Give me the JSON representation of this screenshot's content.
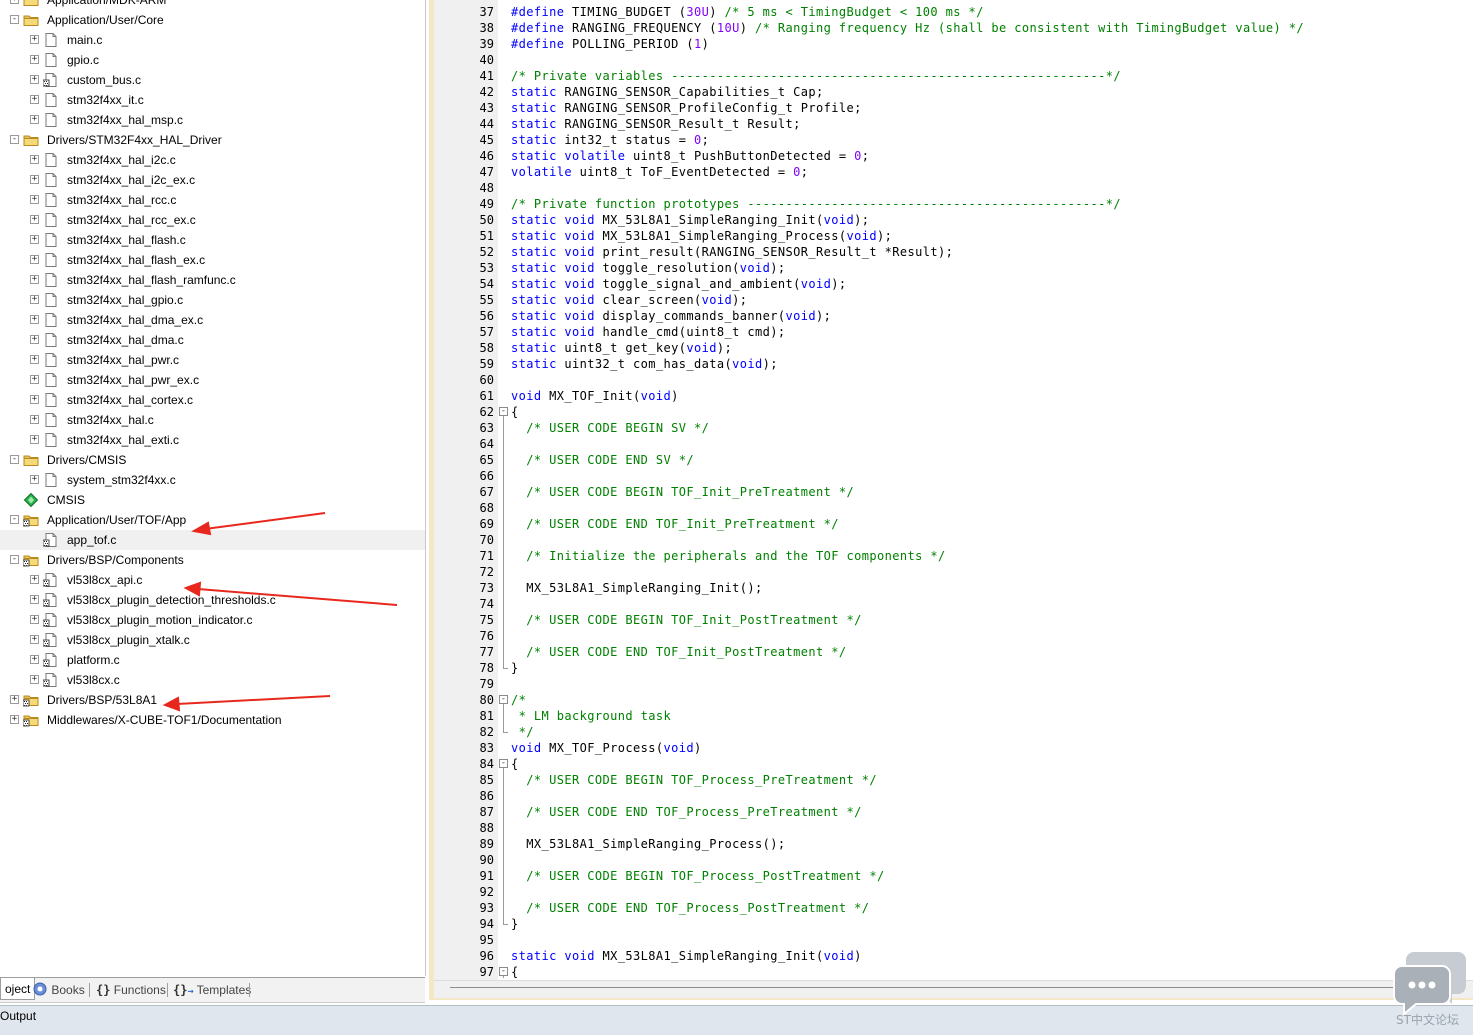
{
  "project_tree": {
    "items": [
      {
        "label": "Application/MDK-ARM",
        "type": "folder",
        "expander": "+"
      },
      {
        "label": "Application/User/Core",
        "type": "folder",
        "expander": "-"
      },
      {
        "label": "main.c",
        "type": "file",
        "expander": "+"
      },
      {
        "label": "gpio.c",
        "type": "file",
        "expander": "+"
      },
      {
        "label": "custom_bus.c",
        "type": "file-locked",
        "expander": "+"
      },
      {
        "label": "stm32f4xx_it.c",
        "type": "file",
        "expander": "+"
      },
      {
        "label": "stm32f4xx_hal_msp.c",
        "type": "file",
        "expander": "+"
      },
      {
        "label": "Drivers/STM32F4xx_HAL_Driver",
        "type": "folder",
        "expander": "-"
      },
      {
        "label": "stm32f4xx_hal_i2c.c",
        "type": "file",
        "expander": "+"
      },
      {
        "label": "stm32f4xx_hal_i2c_ex.c",
        "type": "file",
        "expander": "+"
      },
      {
        "label": "stm32f4xx_hal_rcc.c",
        "type": "file",
        "expander": "+"
      },
      {
        "label": "stm32f4xx_hal_rcc_ex.c",
        "type": "file",
        "expander": "+"
      },
      {
        "label": "stm32f4xx_hal_flash.c",
        "type": "file",
        "expander": "+"
      },
      {
        "label": "stm32f4xx_hal_flash_ex.c",
        "type": "file",
        "expander": "+"
      },
      {
        "label": "stm32f4xx_hal_flash_ramfunc.c",
        "type": "file",
        "expander": "+"
      },
      {
        "label": "stm32f4xx_hal_gpio.c",
        "type": "file",
        "expander": "+"
      },
      {
        "label": "stm32f4xx_hal_dma_ex.c",
        "type": "file",
        "expander": "+"
      },
      {
        "label": "stm32f4xx_hal_dma.c",
        "type": "file",
        "expander": "+"
      },
      {
        "label": "stm32f4xx_hal_pwr.c",
        "type": "file",
        "expander": "+"
      },
      {
        "label": "stm32f4xx_hal_pwr_ex.c",
        "type": "file",
        "expander": "+"
      },
      {
        "label": "stm32f4xx_hal_cortex.c",
        "type": "file",
        "expander": "+"
      },
      {
        "label": "stm32f4xx_hal.c",
        "type": "file",
        "expander": "+"
      },
      {
        "label": "stm32f4xx_hal_exti.c",
        "type": "file",
        "expander": "+"
      },
      {
        "label": "Drivers/CMSIS",
        "type": "folder",
        "expander": "-"
      },
      {
        "label": "system_stm32f4xx.c",
        "type": "file",
        "expander": "+"
      },
      {
        "label": "CMSIS",
        "type": "component",
        "expander": ""
      },
      {
        "label": "Application/User/TOF/App",
        "type": "folder-locked",
        "expander": "-"
      },
      {
        "label": "app_tof.c",
        "type": "file-locked",
        "expander": "",
        "selected": true
      },
      {
        "label": "Drivers/BSP/Components",
        "type": "folder-locked",
        "expander": "-"
      },
      {
        "label": "vl53l8cx_api.c",
        "type": "file-locked",
        "expander": "+"
      },
      {
        "label": "vl53l8cx_plugin_detection_thresholds.c",
        "type": "file-locked",
        "expander": "+"
      },
      {
        "label": "vl53l8cx_plugin_motion_indicator.c",
        "type": "file-locked",
        "expander": "+"
      },
      {
        "label": "vl53l8cx_plugin_xtalk.c",
        "type": "file-locked",
        "expander": "+"
      },
      {
        "label": "platform.c",
        "type": "file-locked",
        "expander": "+"
      },
      {
        "label": "vl53l8cx.c",
        "type": "file-locked",
        "expander": "+"
      },
      {
        "label": "Drivers/BSP/53L8A1",
        "type": "folder-locked",
        "expander": "+"
      },
      {
        "label": "Middlewares/X-CUBE-TOF1/Documentation",
        "type": "folder-locked",
        "expander": "+"
      }
    ]
  },
  "bottom_tabs": {
    "project": "oject",
    "books": "Books",
    "functions": "Functions",
    "templates": "Templates"
  },
  "output": {
    "label": "Output"
  },
  "watermark": {
    "text": "ST中文论坛"
  },
  "colors": {
    "keyword": "#0000ff",
    "comment": "#008000",
    "number": "#8000ff",
    "arrow": "#e8281d"
  },
  "editor": {
    "lines": [
      {
        "n": "37",
        "tokens": [
          [
            "k",
            "#define"
          ],
          [
            "",
            " TIMING_BUDGET "
          ],
          [
            "",
            "("
          ],
          [
            "n",
            "30U"
          ],
          [
            "",
            ") "
          ],
          [
            "c",
            "/* 5 ms < TimingBudget < 100 ms */"
          ]
        ]
      },
      {
        "n": "38",
        "tokens": [
          [
            "k",
            "#define"
          ],
          [
            "",
            " RANGING_FREQUENCY "
          ],
          [
            "",
            "("
          ],
          [
            "n",
            "10U"
          ],
          [
            "",
            ") "
          ],
          [
            "c",
            "/* Ranging frequency Hz (shall be consistent with TimingBudget value) */"
          ]
        ]
      },
      {
        "n": "39",
        "tokens": [
          [
            "k",
            "#define"
          ],
          [
            "",
            " POLLING_PERIOD "
          ],
          [
            "",
            "("
          ],
          [
            "n",
            "1"
          ],
          [
            "",
            ")"
          ]
        ]
      },
      {
        "n": "40",
        "tokens": []
      },
      {
        "n": "41",
        "tokens": [
          [
            "c",
            "/* Private variables ---------------------------------------------------------*/"
          ]
        ]
      },
      {
        "n": "42",
        "tokens": [
          [
            "k",
            "static"
          ],
          [
            "",
            " RANGING_SENSOR_Capabilities_t Cap;"
          ]
        ]
      },
      {
        "n": "43",
        "tokens": [
          [
            "k",
            "static"
          ],
          [
            "",
            " RANGING_SENSOR_ProfileConfig_t Profile;"
          ]
        ]
      },
      {
        "n": "44",
        "tokens": [
          [
            "k",
            "static"
          ],
          [
            "",
            " RANGING_SENSOR_Result_t Result;"
          ]
        ]
      },
      {
        "n": "45",
        "tokens": [
          [
            "k",
            "static"
          ],
          [
            "",
            " int32_t status = "
          ],
          [
            "n",
            "0"
          ],
          [
            "",
            ";"
          ]
        ]
      },
      {
        "n": "46",
        "tokens": [
          [
            "k",
            "static"
          ],
          [
            "",
            " "
          ],
          [
            "k",
            "volatile"
          ],
          [
            "",
            " uint8_t PushButtonDetected = "
          ],
          [
            "n",
            "0"
          ],
          [
            "",
            ";"
          ]
        ]
      },
      {
        "n": "47",
        "tokens": [
          [
            "k",
            "volatile"
          ],
          [
            "",
            " uint8_t ToF_EventDetected = "
          ],
          [
            "n",
            "0"
          ],
          [
            "",
            ";"
          ]
        ]
      },
      {
        "n": "48",
        "tokens": []
      },
      {
        "n": "49",
        "tokens": [
          [
            "c",
            "/* Private function prototypes -----------------------------------------------*/"
          ]
        ]
      },
      {
        "n": "50",
        "tokens": [
          [
            "k",
            "static"
          ],
          [
            "",
            " "
          ],
          [
            "k",
            "void"
          ],
          [
            "",
            " MX_53L8A1_SimpleRanging_Init("
          ],
          [
            "k",
            "void"
          ],
          [
            "",
            ");"
          ]
        ]
      },
      {
        "n": "51",
        "tokens": [
          [
            "k",
            "static"
          ],
          [
            "",
            " "
          ],
          [
            "k",
            "void"
          ],
          [
            "",
            " MX_53L8A1_SimpleRanging_Process("
          ],
          [
            "k",
            "void"
          ],
          [
            "",
            ");"
          ]
        ]
      },
      {
        "n": "52",
        "tokens": [
          [
            "k",
            "static"
          ],
          [
            "",
            " "
          ],
          [
            "k",
            "void"
          ],
          [
            "",
            " print_result(RANGING_SENSOR_Result_t *Result);"
          ]
        ]
      },
      {
        "n": "53",
        "tokens": [
          [
            "k",
            "static"
          ],
          [
            "",
            " "
          ],
          [
            "k",
            "void"
          ],
          [
            "",
            " toggle_resolution("
          ],
          [
            "k",
            "void"
          ],
          [
            "",
            ");"
          ]
        ]
      },
      {
        "n": "54",
        "tokens": [
          [
            "k",
            "static"
          ],
          [
            "",
            " "
          ],
          [
            "k",
            "void"
          ],
          [
            "",
            " toggle_signal_and_ambient("
          ],
          [
            "k",
            "void"
          ],
          [
            "",
            ");"
          ]
        ]
      },
      {
        "n": "55",
        "tokens": [
          [
            "k",
            "static"
          ],
          [
            "",
            " "
          ],
          [
            "k",
            "void"
          ],
          [
            "",
            " clear_screen("
          ],
          [
            "k",
            "void"
          ],
          [
            "",
            ");"
          ]
        ]
      },
      {
        "n": "56",
        "tokens": [
          [
            "k",
            "static"
          ],
          [
            "",
            " "
          ],
          [
            "k",
            "void"
          ],
          [
            "",
            " display_commands_banner("
          ],
          [
            "k",
            "void"
          ],
          [
            "",
            ");"
          ]
        ]
      },
      {
        "n": "57",
        "tokens": [
          [
            "k",
            "static"
          ],
          [
            "",
            " "
          ],
          [
            "k",
            "void"
          ],
          [
            "",
            " handle_cmd(uint8_t cmd);"
          ]
        ]
      },
      {
        "n": "58",
        "tokens": [
          [
            "k",
            "static"
          ],
          [
            "",
            " uint8_t get_key("
          ],
          [
            "k",
            "void"
          ],
          [
            "",
            ");"
          ]
        ]
      },
      {
        "n": "59",
        "tokens": [
          [
            "k",
            "static"
          ],
          [
            "",
            " uint32_t com_has_data("
          ],
          [
            "k",
            "void"
          ],
          [
            "",
            ");"
          ]
        ]
      },
      {
        "n": "60",
        "tokens": []
      },
      {
        "n": "61",
        "tokens": [
          [
            "k",
            "void"
          ],
          [
            "",
            " MX_TOF_Init("
          ],
          [
            "k",
            "void"
          ],
          [
            "",
            ")"
          ]
        ]
      },
      {
        "n": "62",
        "tokens": [
          [
            "",
            "{"
          ]
        ],
        "fold": "open"
      },
      {
        "n": "63",
        "tokens": [
          [
            "",
            "  "
          ],
          [
            "c",
            "/* USER CODE BEGIN SV */"
          ]
        ]
      },
      {
        "n": "64",
        "tokens": []
      },
      {
        "n": "65",
        "tokens": [
          [
            "",
            "  "
          ],
          [
            "c",
            "/* USER CODE END SV */"
          ]
        ]
      },
      {
        "n": "66",
        "tokens": []
      },
      {
        "n": "67",
        "tokens": [
          [
            "",
            "  "
          ],
          [
            "c",
            "/* USER CODE BEGIN TOF_Init_PreTreatment */"
          ]
        ]
      },
      {
        "n": "68",
        "tokens": []
      },
      {
        "n": "69",
        "tokens": [
          [
            "",
            "  "
          ],
          [
            "c",
            "/* USER CODE END TOF_Init_PreTreatment */"
          ]
        ]
      },
      {
        "n": "70",
        "tokens": []
      },
      {
        "n": "71",
        "tokens": [
          [
            "",
            "  "
          ],
          [
            "c",
            "/* Initialize the peripherals and the TOF components */"
          ]
        ]
      },
      {
        "n": "72",
        "tokens": []
      },
      {
        "n": "73",
        "tokens": [
          [
            "",
            "  MX_53L8A1_SimpleRanging_Init();"
          ]
        ]
      },
      {
        "n": "74",
        "tokens": []
      },
      {
        "n": "75",
        "tokens": [
          [
            "",
            "  "
          ],
          [
            "c",
            "/* USER CODE BEGIN TOF_Init_PostTreatment */"
          ]
        ]
      },
      {
        "n": "76",
        "tokens": []
      },
      {
        "n": "77",
        "tokens": [
          [
            "",
            "  "
          ],
          [
            "c",
            "/* USER CODE END TOF_Init_PostTreatment */"
          ]
        ]
      },
      {
        "n": "78",
        "tokens": [
          [
            "",
            "}"
          ]
        ],
        "fold": "end"
      },
      {
        "n": "79",
        "tokens": []
      },
      {
        "n": "80",
        "tokens": [
          [
            "c",
            "/*"
          ]
        ],
        "fold": "open"
      },
      {
        "n": "81",
        "tokens": [
          [
            "c",
            " * LM background task"
          ]
        ]
      },
      {
        "n": "82",
        "tokens": [
          [
            "c",
            " */"
          ]
        ],
        "fold": "end"
      },
      {
        "n": "83",
        "tokens": [
          [
            "k",
            "void"
          ],
          [
            "",
            " MX_TOF_Process("
          ],
          [
            "k",
            "void"
          ],
          [
            "",
            ")"
          ]
        ]
      },
      {
        "n": "84",
        "tokens": [
          [
            "",
            "{"
          ]
        ],
        "fold": "open"
      },
      {
        "n": "85",
        "tokens": [
          [
            "",
            "  "
          ],
          [
            "c",
            "/* USER CODE BEGIN TOF_Process_PreTreatment */"
          ]
        ]
      },
      {
        "n": "86",
        "tokens": []
      },
      {
        "n": "87",
        "tokens": [
          [
            "",
            "  "
          ],
          [
            "c",
            "/* USER CODE END TOF_Process_PreTreatment */"
          ]
        ]
      },
      {
        "n": "88",
        "tokens": []
      },
      {
        "n": "89",
        "tokens": [
          [
            "",
            "  MX_53L8A1_SimpleRanging_Process();"
          ]
        ]
      },
      {
        "n": "90",
        "tokens": []
      },
      {
        "n": "91",
        "tokens": [
          [
            "",
            "  "
          ],
          [
            "c",
            "/* USER CODE BEGIN TOF_Process_PostTreatment */"
          ]
        ]
      },
      {
        "n": "92",
        "tokens": []
      },
      {
        "n": "93",
        "tokens": [
          [
            "",
            "  "
          ],
          [
            "c",
            "/* USER CODE END TOF_Process_PostTreatment */"
          ]
        ]
      },
      {
        "n": "94",
        "tokens": [
          [
            "",
            "}"
          ]
        ],
        "fold": "end"
      },
      {
        "n": "95",
        "tokens": []
      },
      {
        "n": "96",
        "tokens": [
          [
            "k",
            "static"
          ],
          [
            "",
            " "
          ],
          [
            "k",
            "void"
          ],
          [
            "",
            " MX_53L8A1_SimpleRanging_Init("
          ],
          [
            "k",
            "void"
          ],
          [
            "",
            ")"
          ]
        ]
      },
      {
        "n": "97",
        "tokens": [
          [
            "",
            "{"
          ]
        ],
        "fold": "open"
      }
    ]
  }
}
